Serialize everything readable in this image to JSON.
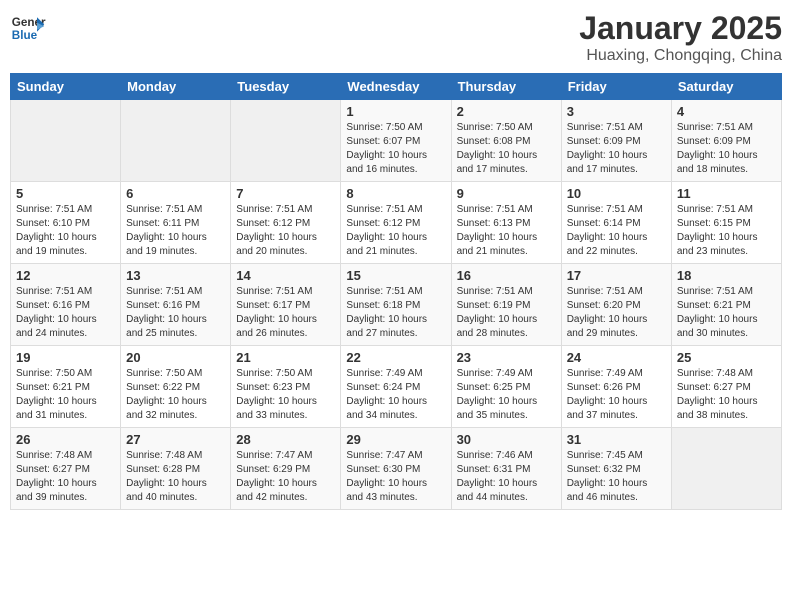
{
  "header": {
    "logo_line1": "General",
    "logo_line2": "Blue",
    "title": "January 2025",
    "subtitle": "Huaxing, Chongqing, China"
  },
  "weekdays": [
    "Sunday",
    "Monday",
    "Tuesday",
    "Wednesday",
    "Thursday",
    "Friday",
    "Saturday"
  ],
  "weeks": [
    [
      {
        "day": "",
        "info": ""
      },
      {
        "day": "",
        "info": ""
      },
      {
        "day": "",
        "info": ""
      },
      {
        "day": "1",
        "info": "Sunrise: 7:50 AM\nSunset: 6:07 PM\nDaylight: 10 hours\nand 16 minutes."
      },
      {
        "day": "2",
        "info": "Sunrise: 7:50 AM\nSunset: 6:08 PM\nDaylight: 10 hours\nand 17 minutes."
      },
      {
        "day": "3",
        "info": "Sunrise: 7:51 AM\nSunset: 6:09 PM\nDaylight: 10 hours\nand 17 minutes."
      },
      {
        "day": "4",
        "info": "Sunrise: 7:51 AM\nSunset: 6:09 PM\nDaylight: 10 hours\nand 18 minutes."
      }
    ],
    [
      {
        "day": "5",
        "info": "Sunrise: 7:51 AM\nSunset: 6:10 PM\nDaylight: 10 hours\nand 19 minutes."
      },
      {
        "day": "6",
        "info": "Sunrise: 7:51 AM\nSunset: 6:11 PM\nDaylight: 10 hours\nand 19 minutes."
      },
      {
        "day": "7",
        "info": "Sunrise: 7:51 AM\nSunset: 6:12 PM\nDaylight: 10 hours\nand 20 minutes."
      },
      {
        "day": "8",
        "info": "Sunrise: 7:51 AM\nSunset: 6:12 PM\nDaylight: 10 hours\nand 21 minutes."
      },
      {
        "day": "9",
        "info": "Sunrise: 7:51 AM\nSunset: 6:13 PM\nDaylight: 10 hours\nand 21 minutes."
      },
      {
        "day": "10",
        "info": "Sunrise: 7:51 AM\nSunset: 6:14 PM\nDaylight: 10 hours\nand 22 minutes."
      },
      {
        "day": "11",
        "info": "Sunrise: 7:51 AM\nSunset: 6:15 PM\nDaylight: 10 hours\nand 23 minutes."
      }
    ],
    [
      {
        "day": "12",
        "info": "Sunrise: 7:51 AM\nSunset: 6:16 PM\nDaylight: 10 hours\nand 24 minutes."
      },
      {
        "day": "13",
        "info": "Sunrise: 7:51 AM\nSunset: 6:16 PM\nDaylight: 10 hours\nand 25 minutes."
      },
      {
        "day": "14",
        "info": "Sunrise: 7:51 AM\nSunset: 6:17 PM\nDaylight: 10 hours\nand 26 minutes."
      },
      {
        "day": "15",
        "info": "Sunrise: 7:51 AM\nSunset: 6:18 PM\nDaylight: 10 hours\nand 27 minutes."
      },
      {
        "day": "16",
        "info": "Sunrise: 7:51 AM\nSunset: 6:19 PM\nDaylight: 10 hours\nand 28 minutes."
      },
      {
        "day": "17",
        "info": "Sunrise: 7:51 AM\nSunset: 6:20 PM\nDaylight: 10 hours\nand 29 minutes."
      },
      {
        "day": "18",
        "info": "Sunrise: 7:51 AM\nSunset: 6:21 PM\nDaylight: 10 hours\nand 30 minutes."
      }
    ],
    [
      {
        "day": "19",
        "info": "Sunrise: 7:50 AM\nSunset: 6:21 PM\nDaylight: 10 hours\nand 31 minutes."
      },
      {
        "day": "20",
        "info": "Sunrise: 7:50 AM\nSunset: 6:22 PM\nDaylight: 10 hours\nand 32 minutes."
      },
      {
        "day": "21",
        "info": "Sunrise: 7:50 AM\nSunset: 6:23 PM\nDaylight: 10 hours\nand 33 minutes."
      },
      {
        "day": "22",
        "info": "Sunrise: 7:49 AM\nSunset: 6:24 PM\nDaylight: 10 hours\nand 34 minutes."
      },
      {
        "day": "23",
        "info": "Sunrise: 7:49 AM\nSunset: 6:25 PM\nDaylight: 10 hours\nand 35 minutes."
      },
      {
        "day": "24",
        "info": "Sunrise: 7:49 AM\nSunset: 6:26 PM\nDaylight: 10 hours\nand 37 minutes."
      },
      {
        "day": "25",
        "info": "Sunrise: 7:48 AM\nSunset: 6:27 PM\nDaylight: 10 hours\nand 38 minutes."
      }
    ],
    [
      {
        "day": "26",
        "info": "Sunrise: 7:48 AM\nSunset: 6:27 PM\nDaylight: 10 hours\nand 39 minutes."
      },
      {
        "day": "27",
        "info": "Sunrise: 7:48 AM\nSunset: 6:28 PM\nDaylight: 10 hours\nand 40 minutes."
      },
      {
        "day": "28",
        "info": "Sunrise: 7:47 AM\nSunset: 6:29 PM\nDaylight: 10 hours\nand 42 minutes."
      },
      {
        "day": "29",
        "info": "Sunrise: 7:47 AM\nSunset: 6:30 PM\nDaylight: 10 hours\nand 43 minutes."
      },
      {
        "day": "30",
        "info": "Sunrise: 7:46 AM\nSunset: 6:31 PM\nDaylight: 10 hours\nand 44 minutes."
      },
      {
        "day": "31",
        "info": "Sunrise: 7:45 AM\nSunset: 6:32 PM\nDaylight: 10 hours\nand 46 minutes."
      },
      {
        "day": "",
        "info": ""
      }
    ]
  ]
}
